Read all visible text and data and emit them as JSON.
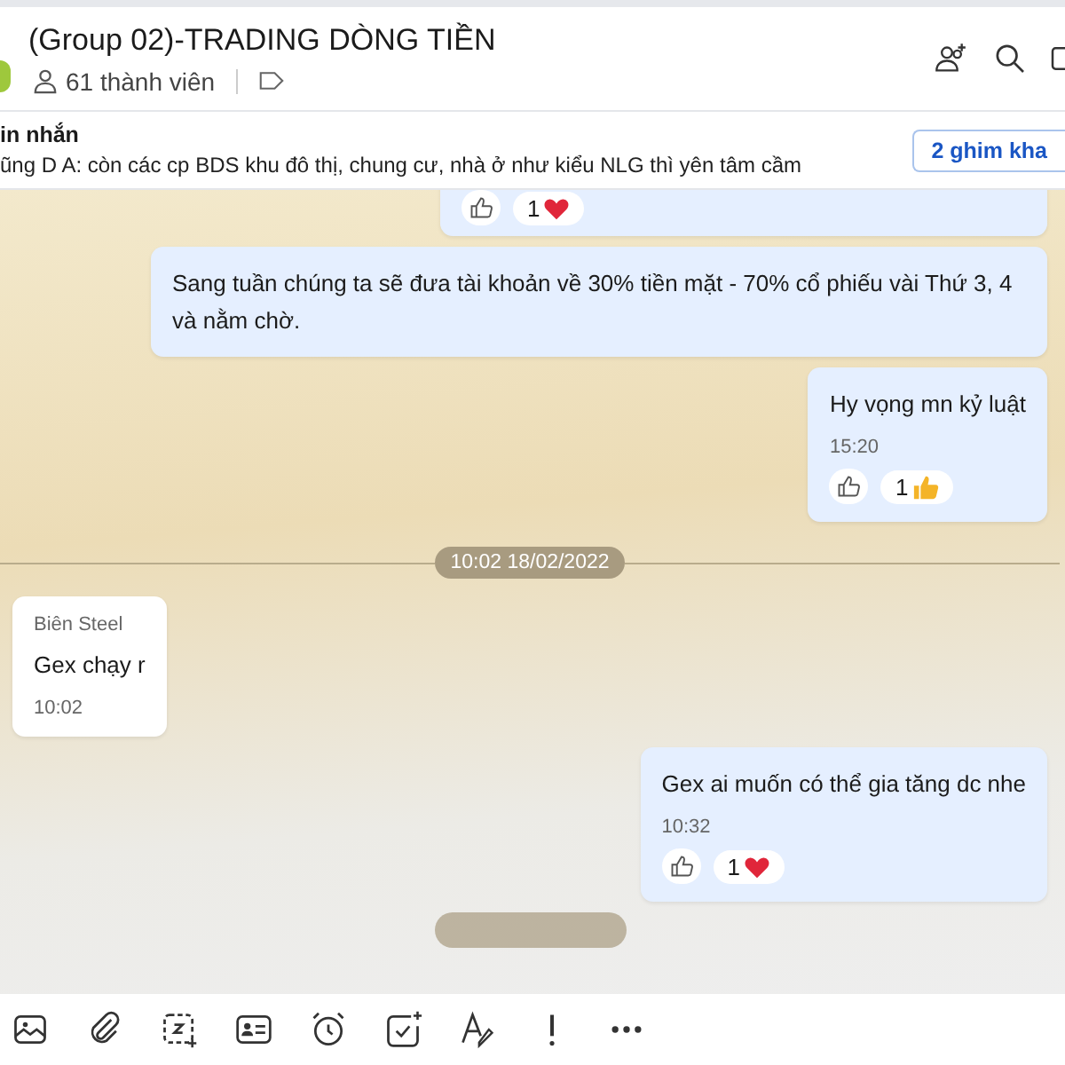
{
  "header": {
    "title": "(Group 02)-TRADING DÒNG TIỀN",
    "members": "61 thành viên"
  },
  "pinned": {
    "title": "in nhắn",
    "text": "ũng D A: còn các cp BDS khu đô thị, chung cư, nhà ở như kiểu NLG thì yên tâm cầm",
    "button": "2 ghim kha"
  },
  "messages": [
    {
      "kind": "outgoing",
      "reactions": [
        {
          "kind": "heart",
          "count": "1"
        }
      ]
    },
    {
      "kind": "outgoing",
      "text": "Sang tuần chúng ta sẽ đưa tài khoản về 30% tiền mặt - 70% cổ phiếu vài Thứ 3, 4 và nằm chờ."
    },
    {
      "kind": "outgoing",
      "text": "Hy vọng mn kỷ luật",
      "time": "15:20",
      "reactions": [
        {
          "kind": "thumb",
          "count": "1"
        }
      ]
    },
    {
      "kind": "date",
      "text": "10:02 18/02/2022"
    },
    {
      "kind": "incoming",
      "sender": "Biên Steel",
      "text": "Gex chạy r",
      "time": "10:02"
    },
    {
      "kind": "outgoing",
      "text": "Gex ai muốn có thể gia tăng dc nhe",
      "time": "10:32",
      "reactions": [
        {
          "kind": "heart",
          "count": "1"
        }
      ]
    },
    {
      "kind": "date-cut"
    }
  ]
}
